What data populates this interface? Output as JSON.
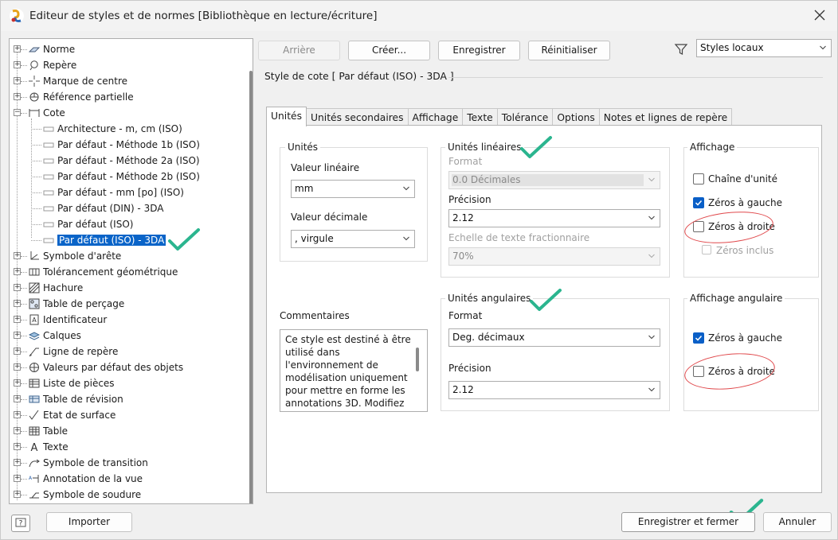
{
  "window": {
    "title": "Editeur de styles et de normes [Bibliothèque en lecture/écriture]"
  },
  "toolbar": {
    "back": "Arrière",
    "create": "Créer...",
    "save": "Enregistrer",
    "reset": "Réinitialiser",
    "filter_value": "Styles locaux"
  },
  "style_header": "Style de cote [ Par défaut (ISO) - 3DA ]",
  "tree": {
    "items": [
      {
        "label": "Norme",
        "icon": "norme-icon"
      },
      {
        "label": "Repère",
        "icon": "repere-icon"
      },
      {
        "label": "Marque de centre",
        "icon": "center-mark-icon"
      },
      {
        "label": "Référence partielle",
        "icon": "datum-target-icon"
      },
      {
        "label": "Cote",
        "icon": "dimension-icon"
      },
      {
        "label": "Architecture - m, cm (ISO)",
        "icon": "dimension-style-icon"
      },
      {
        "label": "Par défaut - Méthode 1b (ISO)",
        "icon": "dimension-style-icon"
      },
      {
        "label": "Par défaut - Méthode 2a (ISO)",
        "icon": "dimension-style-icon"
      },
      {
        "label": "Par défaut - Méthode 2b (ISO)",
        "icon": "dimension-style-icon"
      },
      {
        "label": "Par défaut - mm [po] (ISO)",
        "icon": "dimension-style-icon"
      },
      {
        "label": "Par défaut (DIN) - 3DA",
        "icon": "dimension-style-icon"
      },
      {
        "label": "Par défaut (ISO)",
        "icon": "dimension-style-icon"
      },
      {
        "label": "Par défaut (ISO) - 3DA",
        "icon": "dimension-style-icon"
      },
      {
        "label": "Symbole d'arête",
        "icon": "edge-symbol-icon"
      },
      {
        "label": "Tolérancement géométrique",
        "icon": "feature-control-icon"
      },
      {
        "label": "Hachure",
        "icon": "hatch-icon"
      },
      {
        "label": "Table de perçage",
        "icon": "hole-table-icon"
      },
      {
        "label": "Identificateur",
        "icon": "identifier-icon"
      },
      {
        "label": "Calques",
        "icon": "layers-icon"
      },
      {
        "label": "Ligne de repère",
        "icon": "leader-icon"
      },
      {
        "label": "Valeurs par défaut des objets",
        "icon": "object-defaults-icon"
      },
      {
        "label": "Liste de pièces",
        "icon": "parts-list-icon"
      },
      {
        "label": "Table de révision",
        "icon": "revision-table-icon"
      },
      {
        "label": "Etat de surface",
        "icon": "surface-texture-icon"
      },
      {
        "label": "Table",
        "icon": "table-icon"
      },
      {
        "label": "Texte",
        "icon": "text-icon"
      },
      {
        "label": "Symbole de transition",
        "icon": "transition-icon"
      },
      {
        "label": "Annotation de la vue",
        "icon": "view-annotation-icon"
      },
      {
        "label": "Symbole de soudure",
        "icon": "weld-icon"
      }
    ]
  },
  "tabs": [
    "Unités",
    "Unités secondaires",
    "Affichage",
    "Texte",
    "Tolérance",
    "Options",
    "Notes et lignes de repère"
  ],
  "units_group": {
    "title": "Unités",
    "linear_label": "Valeur linéaire",
    "linear_value": "mm",
    "decimal_label": "Valeur décimale",
    "decimal_value": ", virgule"
  },
  "linear_units": {
    "title": "Unités linéaires",
    "format_label": "Format",
    "format_value": "0.0 Décimales",
    "precision_label": "Précision",
    "precision_value": "2.12",
    "fraction_label": "Echelle de texte fractionnaire",
    "fraction_value": "70%"
  },
  "display": {
    "title": "Affichage",
    "unit_string": "Chaîne d'unité",
    "leading_zeros": "Zéros à gauche",
    "trailing_zeros": "Zéros à droite",
    "zeros_included": "Zéros inclus"
  },
  "comments": {
    "title": "Commentaires",
    "text": "Ce style est destiné à être utilisé dans l'environnement de modélisation uniquement pour mettre en forme les annotations 3D. Modifiez"
  },
  "angular_units": {
    "title": "Unités angulaires",
    "format_label": "Format",
    "format_value": "Deg. décimaux",
    "precision_label": "Précision",
    "precision_value": "2.12"
  },
  "angular_display": {
    "title": "Affichage angulaire",
    "leading_zeros": "Zéros à gauche",
    "trailing_zeros": "Zéros à droite"
  },
  "bottom": {
    "import": "Importer",
    "save_close": "Enregistrer et fermer",
    "cancel": "Annuler"
  },
  "colors": {
    "selection": "#0a64c8",
    "annotation_check": "#2bb58f",
    "annotation_circle": "#e0484b"
  }
}
